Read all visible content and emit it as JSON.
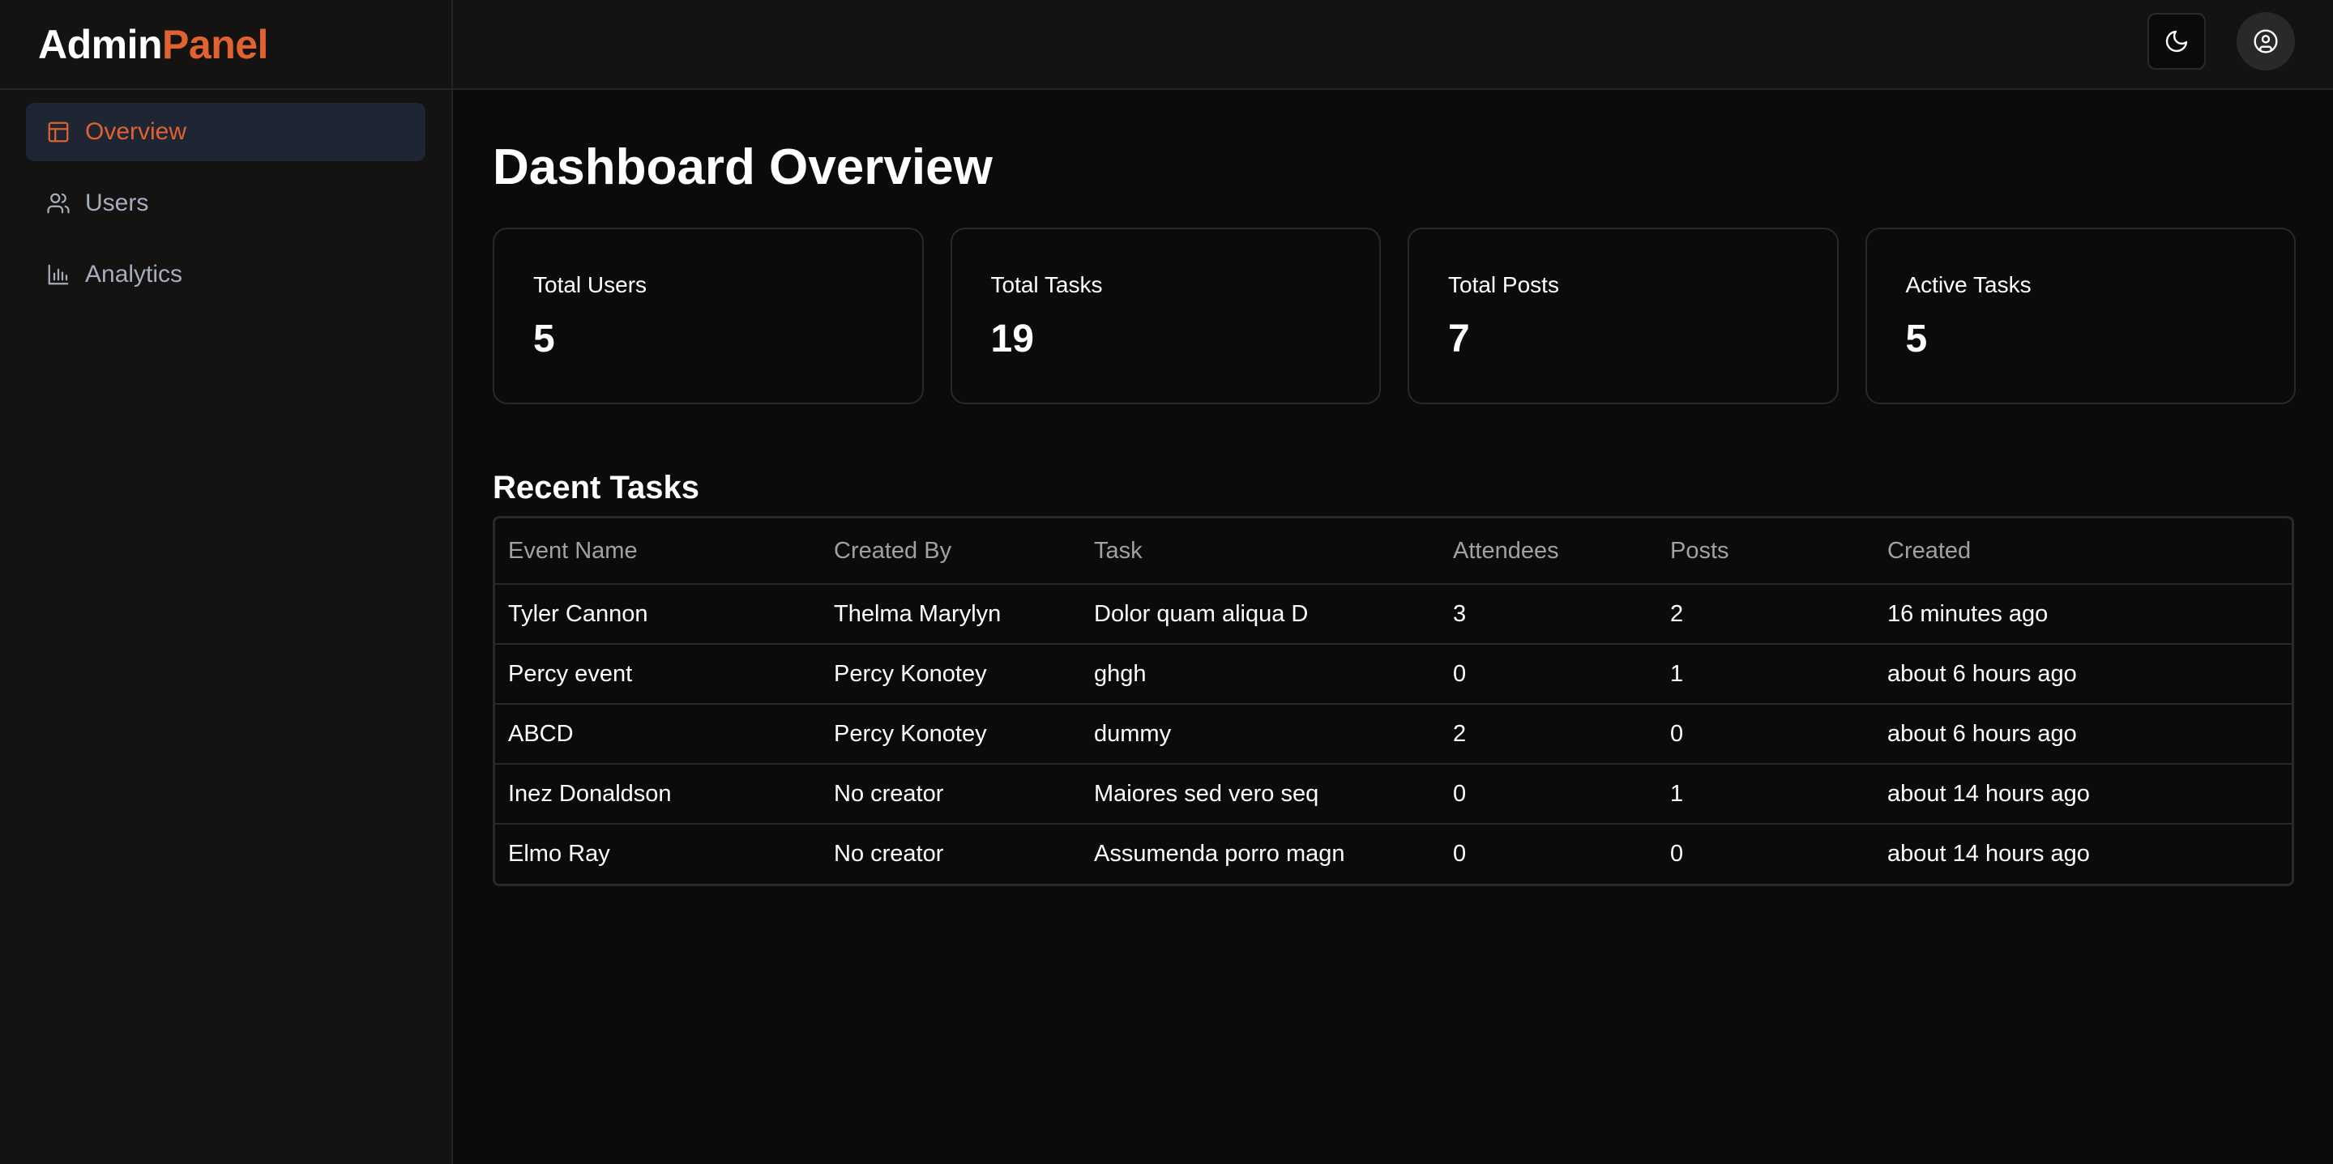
{
  "brand": {
    "part1": "Admin",
    "part2": "Panel"
  },
  "colors": {
    "accent": "#e0622f",
    "background": "#0c0b0a",
    "sidebar": "#141312",
    "active_nav_bg": "#1e2533"
  },
  "sidebar": {
    "items": [
      {
        "label": "Overview",
        "icon": "layout-icon",
        "active": true
      },
      {
        "label": "Users",
        "icon": "users-icon",
        "active": false
      },
      {
        "label": "Analytics",
        "icon": "bar-chart-icon",
        "active": false
      }
    ]
  },
  "topbar": {
    "theme_icon": "moon-icon",
    "account_icon": "user-circle-icon"
  },
  "main": {
    "title": "Dashboard Overview",
    "stats": [
      {
        "label": "Total Users",
        "value": "5"
      },
      {
        "label": "Total Tasks",
        "value": "19"
      },
      {
        "label": "Total Posts",
        "value": "7"
      },
      {
        "label": "Active Tasks",
        "value": "5"
      }
    ],
    "recent_title": "Recent Tasks",
    "table": {
      "headers": [
        "Event Name",
        "Created By",
        "Task",
        "Attendees",
        "Posts",
        "Created"
      ],
      "rows": [
        [
          "Tyler Cannon",
          "Thelma Marylyn",
          "Dolor quam aliqua D",
          "3",
          "2",
          "16 minutes ago"
        ],
        [
          "Percy event",
          "Percy Konotey",
          "ghgh",
          "0",
          "1",
          "about 6 hours ago"
        ],
        [
          "ABCD",
          "Percy Konotey",
          "dummy",
          "2",
          "0",
          "about 6 hours ago"
        ],
        [
          "Inez Donaldson",
          "No creator",
          "Maiores sed vero seq",
          "0",
          "1",
          "about 14 hours ago"
        ],
        [
          "Elmo Ray",
          "No creator",
          "Assumenda porro magn",
          "0",
          "0",
          "about 14 hours ago"
        ]
      ]
    }
  }
}
